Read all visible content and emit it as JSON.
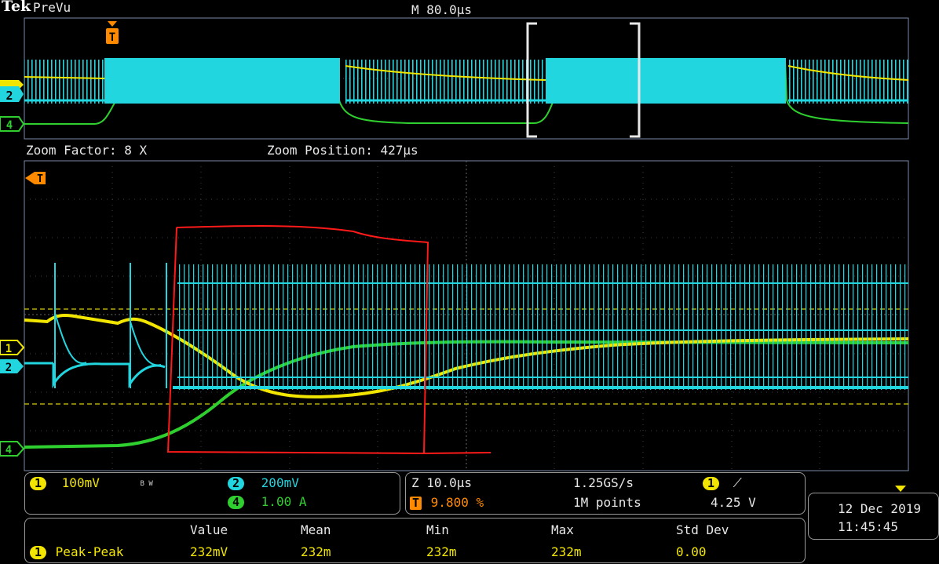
{
  "header": {
    "brand": "Tek",
    "mode": "PreVu",
    "horizontal_scale": "M 80.0µs"
  },
  "zoom": {
    "factor": "Zoom Factor: 8 X",
    "position": "Zoom Position: 427µs"
  },
  "channels": {
    "ch1": {
      "num": "1",
      "scale": "100mV",
      "bw": "B W",
      "color": "#f2e600"
    },
    "ch2": {
      "num": "2",
      "scale": "200mV",
      "color": "#22d6e0"
    },
    "ch4": {
      "num": "4",
      "scale": "1.00 A",
      "color": "#2fcf2f"
    }
  },
  "timebase": {
    "zoom_scale": "Z 10.0µs",
    "sample_rate": "1.25GS/s",
    "trigger_pos": "9.800 %",
    "record_length": "1M points",
    "trigger_channel": "1",
    "trigger_level": "4.25 V"
  },
  "datetime": {
    "date": "12 Dec  2019",
    "time": "11:45:45"
  },
  "measurement": {
    "headers": [
      "Value",
      "Mean",
      "Min",
      "Max",
      "Std Dev"
    ],
    "row": {
      "channel": "1",
      "name": "Peak-Peak",
      "values": [
        "232mV",
        "232m",
        "232m",
        "232m",
        "0.00"
      ]
    }
  },
  "markers": {
    "trigger": "T",
    "ch1_marker": "1",
    "ch2_marker": "2",
    "ch4_marker": "4"
  }
}
